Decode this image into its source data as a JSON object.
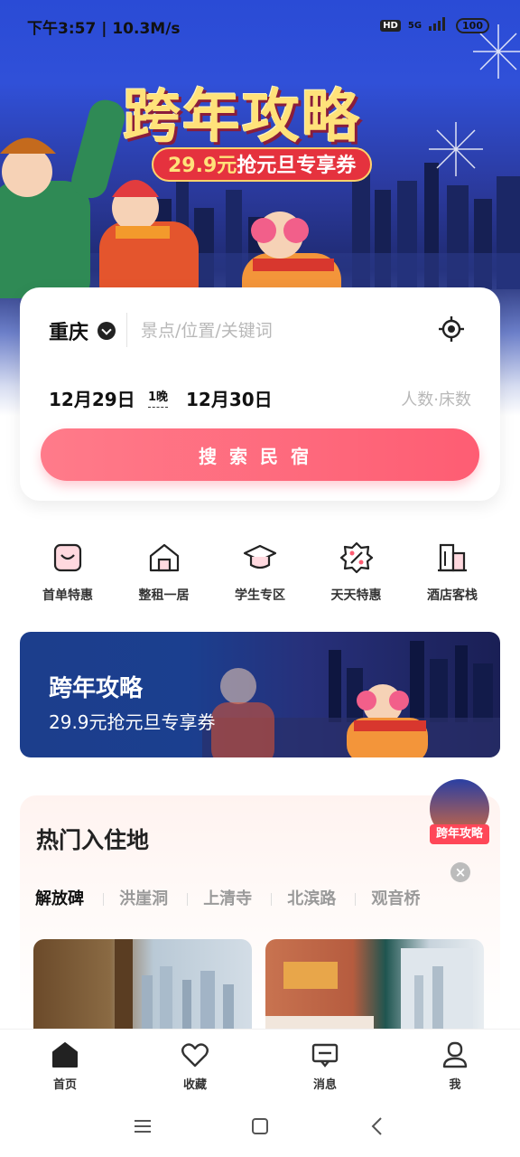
{
  "status_bar": {
    "time": "下午3:57",
    "speed": "10.3M/s",
    "hd": "HD",
    "network": "5G",
    "battery": "100"
  },
  "hero": {
    "title": "跨年攻略",
    "pill_price": "29.9元",
    "pill_text": "抢元旦专享券"
  },
  "search": {
    "city": "重庆",
    "keyword_placeholder": "景点/位置/关键词",
    "checkin": "12月29日",
    "nights": "1晚",
    "checkout": "12月30日",
    "guests_placeholder": "人数·床数",
    "search_button": "搜索民宿"
  },
  "categories": [
    {
      "label": "首单特惠",
      "icon": "shopping-bag-icon"
    },
    {
      "label": "整租一居",
      "icon": "house-icon"
    },
    {
      "label": "学生专区",
      "icon": "graduation-cap-icon"
    },
    {
      "label": "天天特惠",
      "icon": "discount-badge-icon"
    },
    {
      "label": "酒店客栈",
      "icon": "building-icon"
    }
  ],
  "promo": {
    "title": "跨年攻略",
    "subtitle": "29.9元抢元旦专享券"
  },
  "hot_destinations": {
    "title": "热门入住地",
    "tabs": [
      "解放碑",
      "洪崖洞",
      "上清寺",
      "北滨路",
      "观音桥"
    ],
    "active_tab": "解放碑"
  },
  "floating_badge": {
    "label": "跨年攻略"
  },
  "bottom_nav": [
    {
      "label": "首页",
      "icon": "home-icon",
      "active": true
    },
    {
      "label": "收藏",
      "icon": "heart-icon",
      "active": false
    },
    {
      "label": "消息",
      "icon": "message-icon",
      "active": false
    },
    {
      "label": "我",
      "icon": "user-icon",
      "active": false
    }
  ],
  "colors": {
    "accent": "#fe5d73",
    "hero_blue": "#2a4bd6",
    "promo_blue": "#1c3e8c",
    "badge_red": "#ff4758"
  }
}
